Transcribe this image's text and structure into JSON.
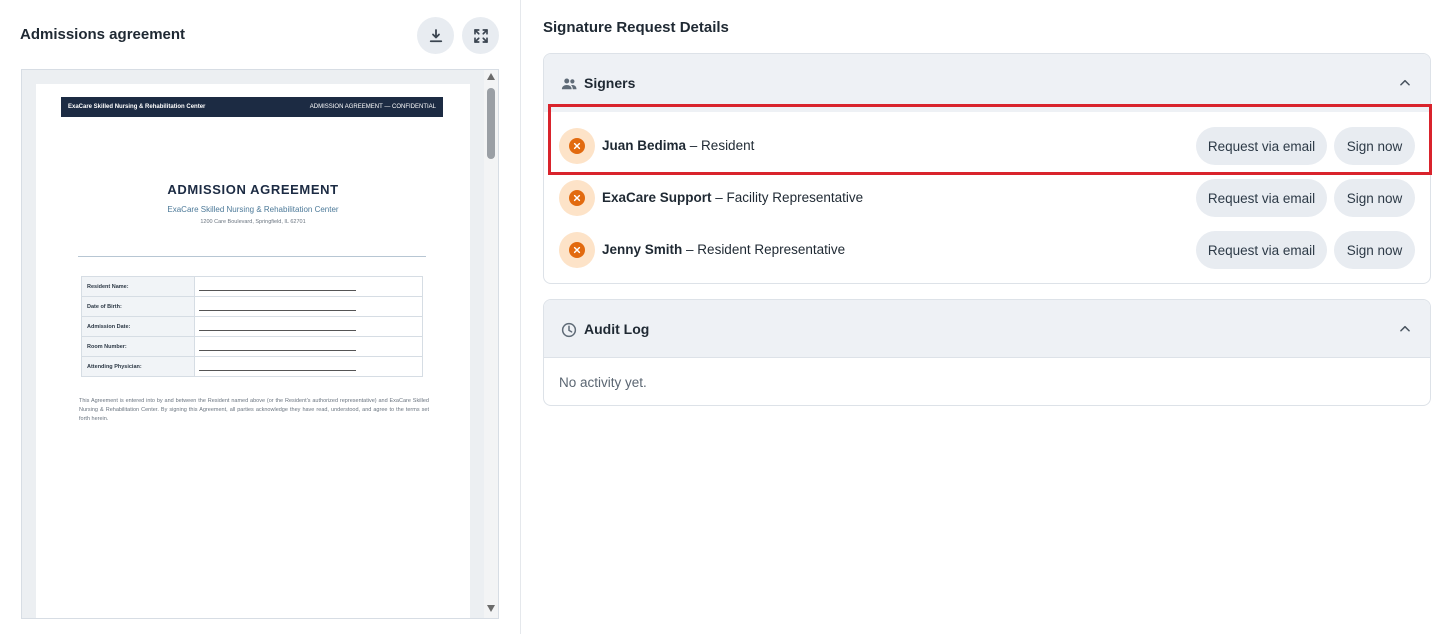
{
  "document": {
    "title": "Admissions agreement",
    "download_icon": "download-icon",
    "fullscreen_icon": "fullscreen-icon",
    "page": {
      "banner_left": "ExaCare Skilled Nursing & Rehabilitation Center",
      "banner_right": "ADMISSION AGREEMENT — CONFIDENTIAL",
      "heading": "ADMISSION AGREEMENT",
      "subheading": "ExaCare Skilled Nursing & Rehabilitation Center",
      "address": "1200 Care Boulevard, Springfield, IL 62701",
      "fields": [
        {
          "label": "Resident Name:"
        },
        {
          "label": "Date of Birth:"
        },
        {
          "label": "Admission Date:"
        },
        {
          "label": "Room Number:"
        },
        {
          "label": "Attending Physician:"
        }
      ],
      "paragraph": "This Agreement is entered into by and between the Resident named above (or the Resident's authorized representative) and ExaCare Skilled Nursing & Rehabilitation Center. By signing this Agreement, all parties acknowledge they have read, understood, and agree to the terms set forth herein."
    }
  },
  "details": {
    "title": "Signature Request Details",
    "signers": {
      "header": "Signers",
      "icon": "people-icon",
      "rows": [
        {
          "name": "Juan Bedima",
          "role": "– Resident",
          "status_icon": "close-circle-icon",
          "request_label": "Request via email",
          "sign_label": "Sign now"
        },
        {
          "name": "ExaCare Support",
          "role": "– Facility Representative",
          "status_icon": "close-circle-icon",
          "request_label": "Request via email",
          "sign_label": "Sign now"
        },
        {
          "name": "Jenny Smith",
          "role": "– Resident Representative",
          "status_icon": "close-circle-icon",
          "request_label": "Request via email",
          "sign_label": "Sign now"
        }
      ]
    },
    "audit": {
      "header": "Audit Log",
      "icon": "clock-icon",
      "empty_text": "No activity yet."
    }
  },
  "colors": {
    "highlight": "#d9232c",
    "status_bg": "#fde3c8",
    "status_fg": "#e26a0f",
    "banner": "#1c2b43"
  }
}
